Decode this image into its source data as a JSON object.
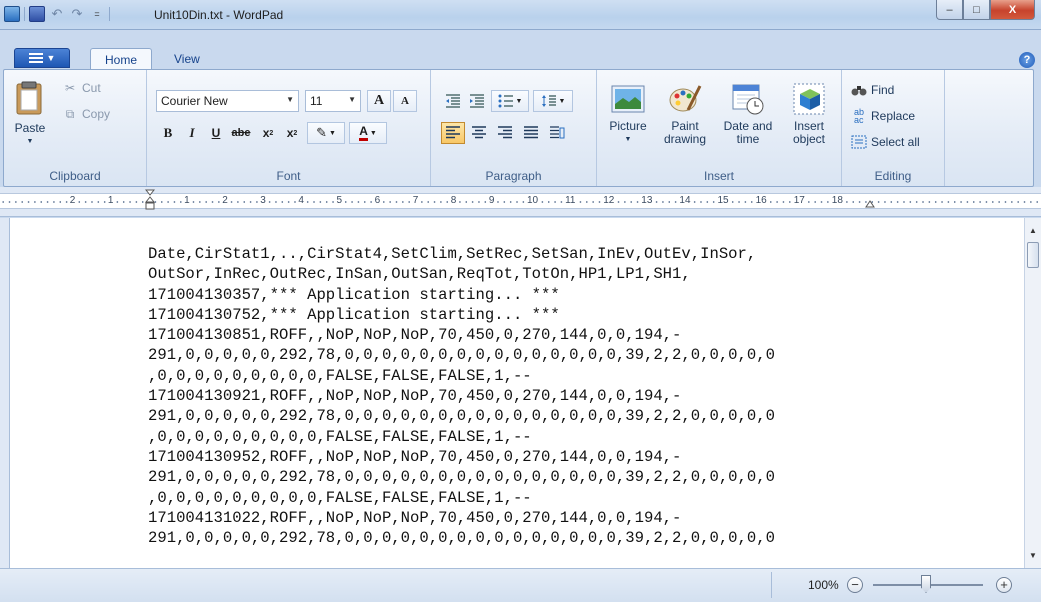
{
  "window": {
    "title": "Unit10Din.txt - WordPad",
    "dropdown_glyph": "=",
    "caption_buttons": {
      "minimize": "–",
      "maximize": "□",
      "close": "X"
    }
  },
  "tabs": {
    "home": "Home",
    "view": "View",
    "help": "?"
  },
  "ribbon": {
    "clipboard": {
      "label": "Clipboard",
      "paste": "Paste",
      "cut": "Cut",
      "copy": "Copy"
    },
    "font": {
      "label": "Font",
      "family": "Courier New",
      "size": "11",
      "grow": "A",
      "shrink": "A",
      "bold": "B",
      "italic": "I",
      "underline": "U",
      "strike": "abe",
      "subscript": "x",
      "superscript": "x",
      "color": "A"
    },
    "paragraph": {
      "label": "Paragraph"
    },
    "insert": {
      "label": "Insert",
      "picture": "Picture",
      "paint_drawing": "Paint\ndrawing",
      "date_time": "Date and\ntime",
      "insert_object": "Insert\nobject"
    },
    "editing": {
      "label": "Editing",
      "find": "Find",
      "replace": "Replace",
      "select_all": "Select all"
    }
  },
  "ruler": {
    "left_numbers": [
      "2",
      "1"
    ],
    "numbers": [
      "1",
      "2",
      "3",
      "4",
      "5",
      "6",
      "7",
      "8",
      "9",
      "10",
      "11",
      "12",
      "13",
      "14",
      "15",
      "16",
      "17",
      "18"
    ]
  },
  "document": {
    "lines": [
      "Date,CirStat1,..,CirStat4,SetClim,SetRec,SetSan,InEv,OutEv,InSor,",
      "OutSor,InRec,OutRec,InSan,OutSan,ReqTot,TotOn,HP1,LP1,SH1,",
      "171004130357,*** Application starting... ***",
      "171004130752,*** Application starting... ***",
      "171004130851,ROFF,,NoP,NoP,NoP,70,450,0,270,144,0,0,194,-",
      "291,0,0,0,0,0,292,78,0,0,0,0,0,0,0,0,0,0,0,0,0,0,0,39,2,2,0,0,0,0,0",
      ",0,0,0,0,0,0,0,0,0,FALSE,FALSE,FALSE,1,--",
      "171004130921,ROFF,,NoP,NoP,NoP,70,450,0,270,144,0,0,194,-",
      "291,0,0,0,0,0,292,78,0,0,0,0,0,0,0,0,0,0,0,0,0,0,0,39,2,2,0,0,0,0,0",
      ",0,0,0,0,0,0,0,0,0,FALSE,FALSE,FALSE,1,--",
      "171004130952,ROFF,,NoP,NoP,NoP,70,450,0,270,144,0,0,194,-",
      "291,0,0,0,0,0,292,78,0,0,0,0,0,0,0,0,0,0,0,0,0,0,0,39,2,2,0,0,0,0,0",
      ",0,0,0,0,0,0,0,0,0,FALSE,FALSE,FALSE,1,--",
      "171004131022,ROFF,,NoP,NoP,NoP,70,450,0,270,144,0,0,194,-",
      "291,0,0,0,0,0,292,78,0,0,0,0,0,0,0,0,0,0,0,0,0,0,0,39,2,2,0,0,0,0,0"
    ]
  },
  "statusbar": {
    "zoom": "100%",
    "zoom_out": "−",
    "zoom_in": "+",
    "zoom_level": 1.0
  }
}
